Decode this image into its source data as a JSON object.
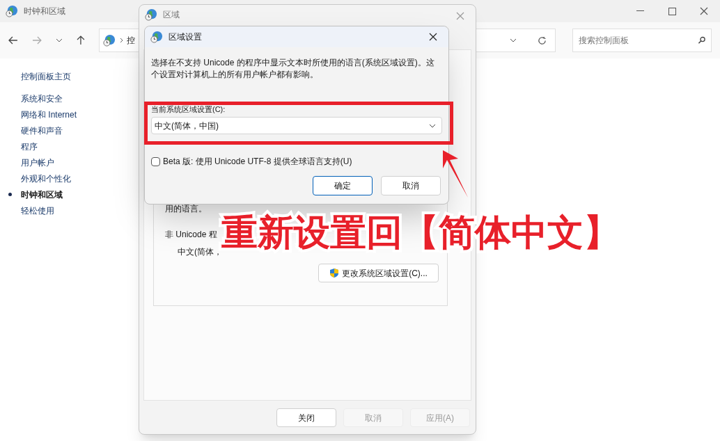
{
  "main_window": {
    "title": "时钟和区域",
    "address_crumb": "控",
    "search": {
      "placeholder": "搜索控制面板"
    },
    "sidebar": [
      {
        "label": "控制面板主页",
        "selected": false
      },
      {
        "label": "系统和安全",
        "selected": false
      },
      {
        "label": "网络和 Internet",
        "selected": false
      },
      {
        "label": "硬件和声音",
        "selected": false
      },
      {
        "label": "程序",
        "selected": false
      },
      {
        "label": "用户帐户",
        "selected": false
      },
      {
        "label": "外观和个性化",
        "selected": false
      },
      {
        "label": "时钟和区域",
        "selected": true
      },
      {
        "label": "轻松使用",
        "selected": false
      }
    ]
  },
  "region_dialog": {
    "title": "区域",
    "group": {
      "text": "用的语言。",
      "label": "非 Unicode 程",
      "value": "中文(简体，",
      "button": "更改系统区域设置(C)..."
    },
    "buttons": [
      {
        "label": "关闭",
        "disabled": false
      },
      {
        "label": "取消",
        "disabled": true
      },
      {
        "label": "应用(A)",
        "disabled": true
      }
    ]
  },
  "locale_dialog": {
    "title": "区域设置",
    "description": "选择在不支持 Unicode 的程序中显示文本时所使用的语言(系统区域设置)。这个设置对计算机上的所有用户帐户都有影响。",
    "field_label": "当前系统区域设置(C):",
    "select_value": "中文(简体，中国)",
    "checkbox": {
      "label": "Beta 版: 使用 Unicode UTF-8 提供全球语言支持(U)",
      "checked": false
    },
    "buttons": [
      {
        "label": "确定",
        "primary": true
      },
      {
        "label": "取消",
        "primary": false
      }
    ]
  },
  "annotation": {
    "text": "重新设置回【简体中文】"
  }
}
